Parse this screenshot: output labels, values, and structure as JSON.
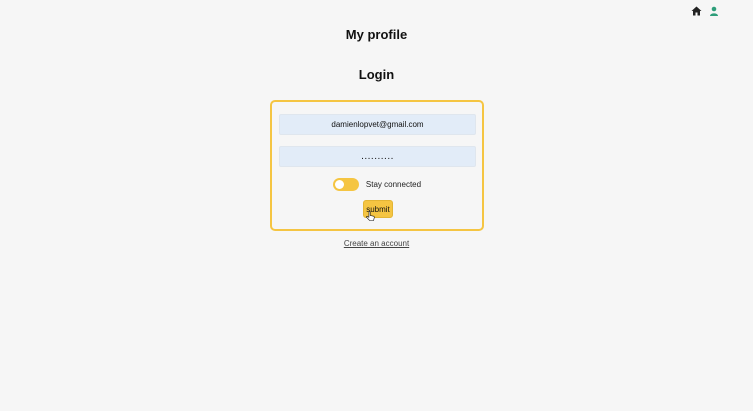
{
  "header": {
    "icons": [
      "home-icon",
      "user-icon"
    ],
    "user_icon_color": "#2e9e7a"
  },
  "page": {
    "title": "My profile"
  },
  "login": {
    "title": "Login",
    "email_value": "damienlopvet@gmail.com",
    "password_value": "..........",
    "stay_connected_label": "Stay connected",
    "stay_connected_checked": false,
    "submit_label": "submit",
    "create_account_label": "Create an account"
  },
  "colors": {
    "accent": "#f5c542",
    "input_bg": "#e2ecf8",
    "background": "#f6f6f6"
  }
}
